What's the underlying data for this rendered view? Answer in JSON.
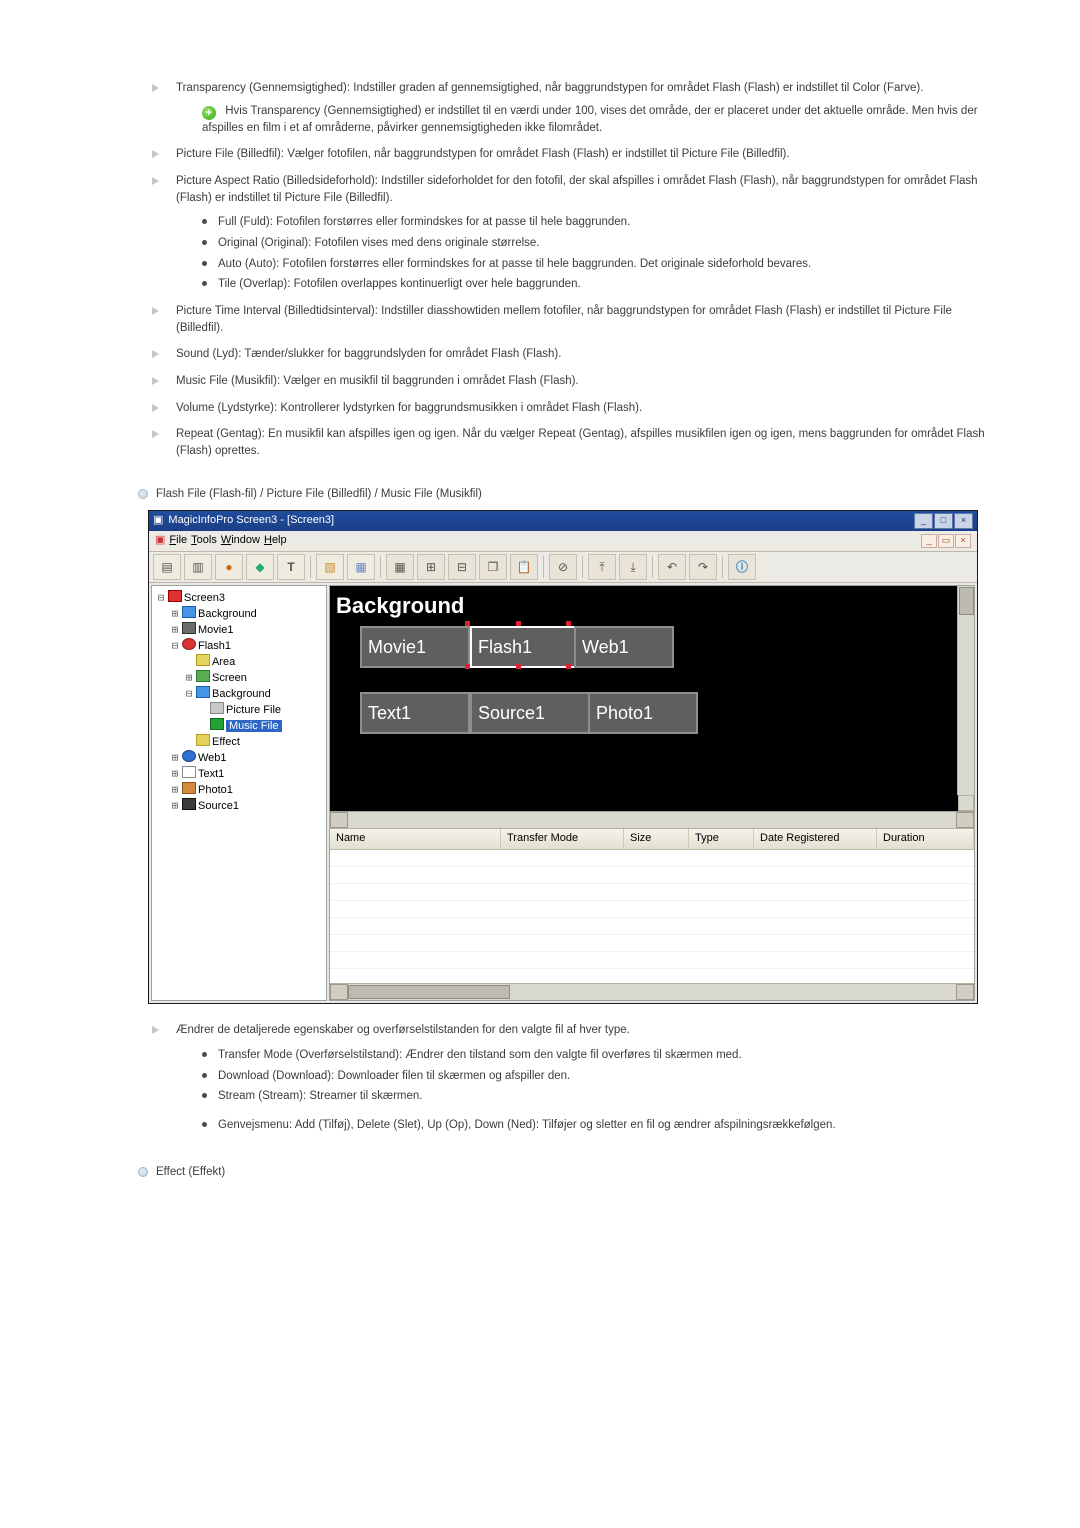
{
  "bullets_arrow_1": [
    {
      "text": "Transparency (Gennemsigtighed): Indstiller graden af gennemsigtighed, når baggrundstypen for området Flash (Flash) er indstillet til Color (Farve).",
      "note": "Hvis Transparency (Gennemsigtighed) er indstillet til en værdi under 100, vises det område, der er placeret under det aktuelle område. Men hvis der afspilles en film i et af områderne, påvirker gennemsigtigheden ikke filområdet."
    },
    {
      "text": "Picture File (Billedfil): Vælger fotofilen, når baggrundstypen for området Flash (Flash) er indstillet til Picture File (Billedfil)."
    },
    {
      "text": "Picture Aspect Ratio (Billedsideforhold): Indstiller sideforholdet for den fotofil, der skal afspilles i området Flash (Flash), når baggrundstypen for området Flash (Flash) er indstillet til Picture File (Billedfil).",
      "sub": [
        "Full (Fuld): Fotofilen forstørres eller formindskes for at passe til hele baggrunden.",
        "Original (Original): Fotofilen vises med dens originale størrelse.",
        "Auto (Auto): Fotofilen forstørres eller formindskes for at passe til hele baggrunden. Det originale sideforhold bevares.",
        "Tile (Overlap): Fotofilen overlappes kontinuerligt over hele baggrunden."
      ]
    },
    {
      "text": "Picture Time Interval (Billedtidsinterval): Indstiller diasshowtiden mellem fotofiler, når baggrundstypen for området Flash (Flash) er indstillet til Picture File (Billedfil)."
    },
    {
      "text": "Sound (Lyd): Tænder/slukker for baggrundslyden for området Flash (Flash)."
    },
    {
      "text": "Music File (Musikfil): Vælger en musikfil til baggrunden i området Flash (Flash)."
    },
    {
      "text": "Volume (Lydstyrke): Kontrollerer lydstyrken for baggrundsmusikken i området Flash (Flash)."
    },
    {
      "text": "Repeat (Gentag): En musikfil kan afspilles igen og igen. Når du vælger Repeat (Gentag), afspilles musikfilen igen og igen, mens baggrunden for området Flash (Flash) oprettes."
    }
  ],
  "flash_section_title": "Flash File (Flash-fil) / Picture File (Billedfil) / Music File (Musikfil)",
  "app": {
    "title": "MagicInfoPro Screen3 - [Screen3]",
    "menu": {
      "file": "File",
      "tools": "Tools",
      "window": "Window",
      "help": "Help"
    },
    "tree": {
      "root": "Screen3",
      "items": [
        "Background",
        "Movie1",
        "Flash1",
        "Area",
        "Screen",
        "Background",
        "Picture File",
        "Music File",
        "Effect",
        "Web1",
        "Text1",
        "Photo1",
        "Source1"
      ],
      "selected": "Music File"
    },
    "canvas": {
      "bg": "Background",
      "boxes": {
        "movie": "Movie1",
        "flash": "Flash1",
        "web": "Web1",
        "text": "Text1",
        "source": "Source1",
        "photo": "Photo1"
      }
    },
    "list_headers": {
      "name": "Name",
      "tm": "Transfer Mode",
      "size": "Size",
      "type": "Type",
      "date": "Date Registered",
      "dur": "Duration"
    }
  },
  "bullets_arrow_2": [
    {
      "text": "Ændrer de detaljerede egenskaber og overførselstilstanden for den valgte fil af hver type.",
      "sub": [
        "Transfer Mode (Overførselstilstand): Ændrer den tilstand som den valgte fil overføres til skærmen med.",
        "Download (Download): Downloader filen til skærmen og afspiller den.",
        "Stream (Stream): Streamer til skærmen."
      ],
      "sub2": [
        "Genvejsmenu: Add (Tilføj), Delete (Slet), Up (Op), Down (Ned): Tilføjer og sletter en fil og ændrer afspilningsrækkefølgen."
      ]
    }
  ],
  "effect_section_title": "Effect (Effekt)"
}
